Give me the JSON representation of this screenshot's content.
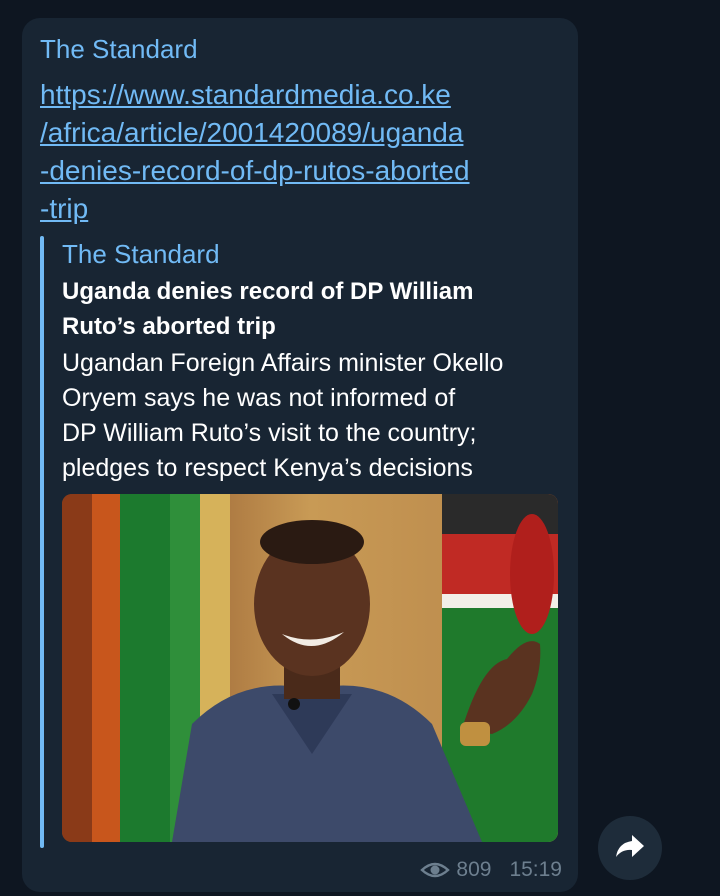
{
  "message": {
    "sender": "The Standard",
    "url_lines": [
      "https://www.standardmedia.co.ke",
      "/africa/article/2001420089/uganda",
      "-denies-record-of-dp-rutos-aborted",
      "-trip"
    ],
    "preview": {
      "site_name": "The Standard",
      "title_lines": [
        "Uganda denies record of DP William",
        "Ruto’s aborted trip"
      ],
      "description_lines": [
        "Ugandan Foreign Affairs minister Okello",
        "Oryem says he was not informed of",
        "DP William Ruto’s visit to the country;",
        "pledges to respect Kenya’s decisions"
      ]
    },
    "views": "809",
    "time": "15:19"
  },
  "icons": {
    "eye": "eye-icon",
    "share": "share-arrow-icon"
  },
  "colors": {
    "background": "#0e1621",
    "bubble": "#182533",
    "accent": "#71baf5",
    "meta_text": "#6d7f8f"
  }
}
